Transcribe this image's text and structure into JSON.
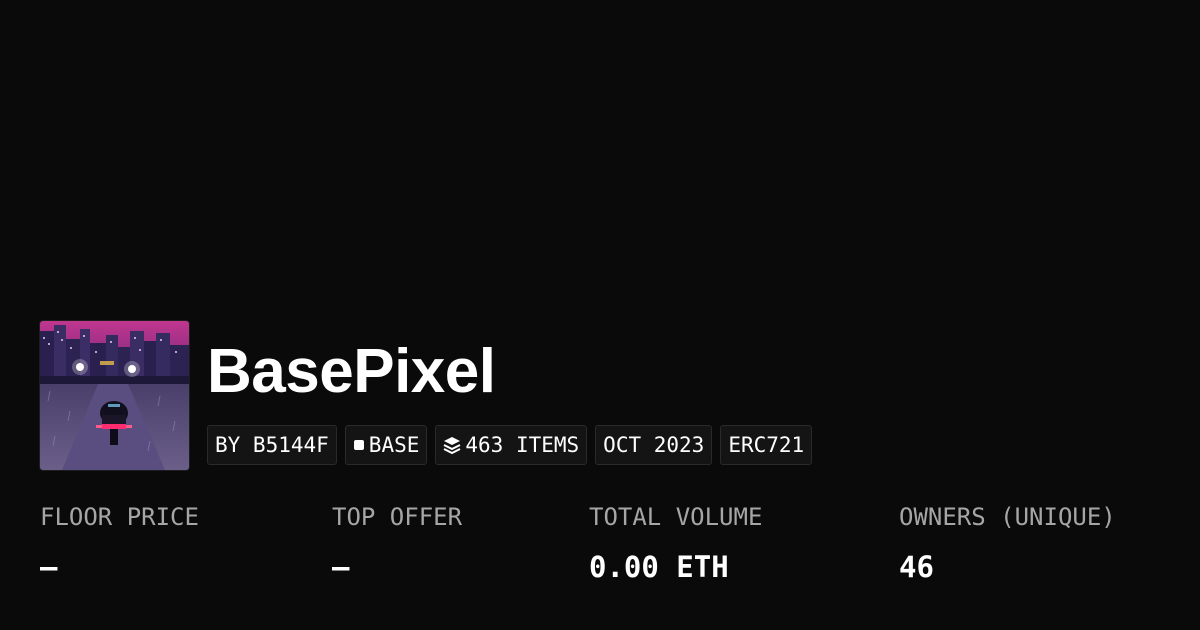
{
  "collection": {
    "name": "BasePixel",
    "image_icon": "pixel-art-motorcycle-city-icon",
    "tags": {
      "creator": "BY B5144F",
      "chain": "BASE",
      "chain_icon": "square-icon",
      "items": "463 ITEMS",
      "items_icon": "layers-icon",
      "date": "OCT 2023",
      "standard": "ERC721"
    }
  },
  "stats": {
    "floor_price": {
      "label": "FLOOR PRICE",
      "value": "–"
    },
    "top_offer": {
      "label": "TOP OFFER",
      "value": "–"
    },
    "total_volume": {
      "label": "TOTAL VOLUME",
      "value": "0.00 ETH"
    },
    "owners": {
      "label": "OWNERS (UNIQUE)",
      "value": "46"
    }
  },
  "colors": {
    "background": "#0a0a0a",
    "tag_background": "#141414",
    "tag_border": "#2a2a2a",
    "label": "#a6a6a6",
    "text": "#ffffff"
  }
}
